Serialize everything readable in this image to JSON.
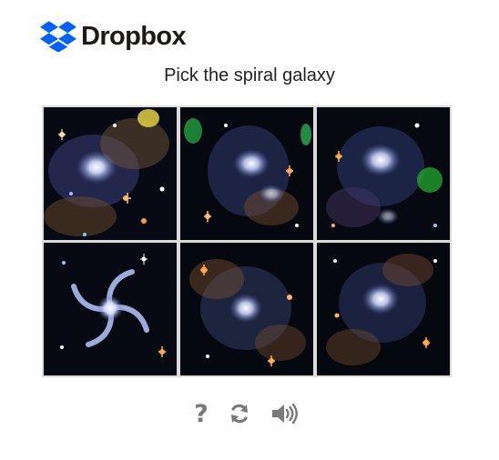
{
  "brand": {
    "name": "Dropbox",
    "logo_color": "#0061fe",
    "text_color": "#1e1919"
  },
  "challenge": {
    "prompt": "Pick the spiral galaxy",
    "images": [
      {
        "index": 1,
        "depicts": "irregular-galaxy",
        "icon": "galaxy-image"
      },
      {
        "index": 2,
        "depicts": "irregular-galaxy",
        "icon": "galaxy-image"
      },
      {
        "index": 3,
        "depicts": "irregular-galaxy",
        "icon": "galaxy-image"
      },
      {
        "index": 4,
        "depicts": "spiral-galaxy",
        "icon": "galaxy-image"
      },
      {
        "index": 5,
        "depicts": "irregular-galaxy",
        "icon": "galaxy-image"
      },
      {
        "index": 6,
        "depicts": "irregular-galaxy",
        "icon": "galaxy-image"
      }
    ]
  },
  "controls": {
    "help_label": "?",
    "icons": [
      "help-icon",
      "refresh-icon",
      "audio-icon"
    ],
    "icon_color": "#7a7a7a"
  }
}
